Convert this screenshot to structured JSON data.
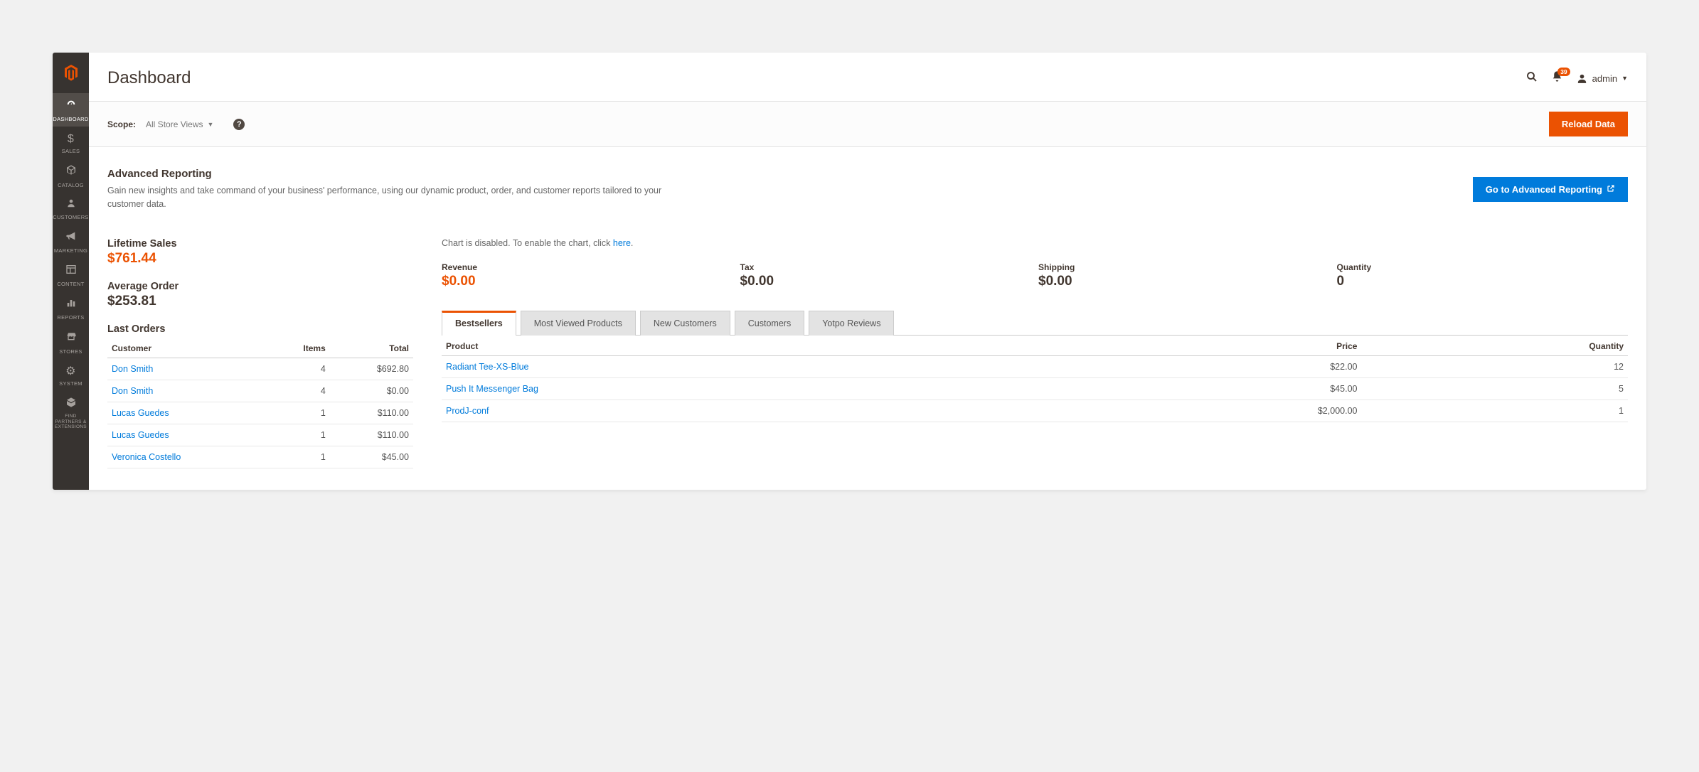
{
  "colors": {
    "accent": "#eb5202",
    "link": "#007bdb"
  },
  "sidebar": {
    "items": [
      {
        "label": "DASHBOARD",
        "icon": "dashboard"
      },
      {
        "label": "SALES",
        "icon": "dollar"
      },
      {
        "label": "CATALOG",
        "icon": "box"
      },
      {
        "label": "CUSTOMERS",
        "icon": "person"
      },
      {
        "label": "MARKETING",
        "icon": "megaphone"
      },
      {
        "label": "CONTENT",
        "icon": "layout"
      },
      {
        "label": "REPORTS",
        "icon": "bars"
      },
      {
        "label": "STORES",
        "icon": "storefront"
      },
      {
        "label": "SYSTEM",
        "icon": "gear"
      },
      {
        "label": "FIND PARTNERS & EXTENSIONS",
        "icon": "cube"
      }
    ]
  },
  "header": {
    "title": "Dashboard",
    "notifications": "39",
    "user": "admin"
  },
  "scope": {
    "label": "Scope:",
    "value": "All Store Views",
    "reload_button": "Reload Data"
  },
  "advanced": {
    "title": "Advanced Reporting",
    "desc": "Gain new insights and take command of your business' performance, using our dynamic product, order, and customer reports tailored to your customer data.",
    "button": "Go to Advanced Reporting"
  },
  "stats": {
    "lifetime_label": "Lifetime Sales",
    "lifetime_value": "$761.44",
    "avg_label": "Average Order",
    "avg_value": "$253.81"
  },
  "last_orders": {
    "title": "Last Orders",
    "headers": {
      "customer": "Customer",
      "items": "Items",
      "total": "Total"
    },
    "rows": [
      {
        "customer": "Don Smith",
        "items": "4",
        "total": "$692.80"
      },
      {
        "customer": "Don Smith",
        "items": "4",
        "total": "$0.00"
      },
      {
        "customer": "Lucas Guedes",
        "items": "1",
        "total": "$110.00"
      },
      {
        "customer": "Lucas Guedes",
        "items": "1",
        "total": "$110.00"
      },
      {
        "customer": "Veronica Costello",
        "items": "1",
        "total": "$45.00"
      }
    ]
  },
  "chart": {
    "msg_prefix": "Chart is disabled. To enable the chart, click ",
    "link": "here",
    "msg_suffix": "."
  },
  "metrics": [
    {
      "label": "Revenue",
      "value": "$0.00",
      "highlight": true
    },
    {
      "label": "Tax",
      "value": "$0.00"
    },
    {
      "label": "Shipping",
      "value": "$0.00"
    },
    {
      "label": "Quantity",
      "value": "0"
    }
  ],
  "tabs": {
    "items": [
      {
        "label": "Bestsellers",
        "active": true
      },
      {
        "label": "Most Viewed Products"
      },
      {
        "label": "New Customers"
      },
      {
        "label": "Customers"
      },
      {
        "label": "Yotpo Reviews"
      }
    ]
  },
  "bestsellers": {
    "headers": {
      "product": "Product",
      "price": "Price",
      "quantity": "Quantity"
    },
    "rows": [
      {
        "product": "Radiant Tee-XS-Blue",
        "price": "$22.00",
        "quantity": "12"
      },
      {
        "product": "Push It Messenger Bag",
        "price": "$45.00",
        "quantity": "5"
      },
      {
        "product": "ProdJ-conf",
        "price": "$2,000.00",
        "quantity": "1"
      }
    ]
  }
}
